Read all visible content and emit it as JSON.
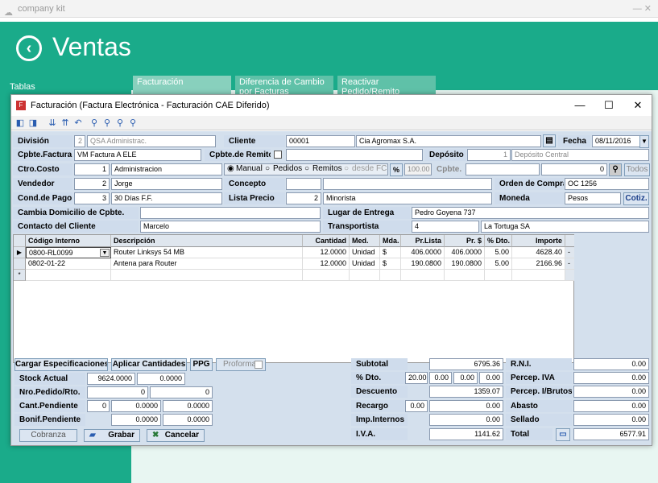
{
  "os": {
    "title": "company kit",
    "controls": "— ✕"
  },
  "app": {
    "title": "Ventas",
    "sidebar_label": "Tablas"
  },
  "tabs": [
    "Facturación",
    "Diferencia de Cambio por Facturas",
    "Reactivar Pedido/Remito facturado"
  ],
  "dialog": {
    "title": "Facturación  (Factura Electrónica - Facturación CAE Diferido)"
  },
  "labels": {
    "division": "División",
    "cliente": "Cliente",
    "fecha": "Fecha",
    "cpbte_factura": "Cpbte.Factura",
    "cpbte_remito": "Cpbte.de Remito",
    "deposito": "Depósito",
    "ctro_costo": "Ctro.Costo",
    "cpbte": "Cpbte.",
    "vendedor": "Vendedor",
    "concepto": "Concepto",
    "orden_compra": "Orden de Compra",
    "cond_pago": "Cond.de Pago",
    "lista_precio": "Lista Precio",
    "moneda": "Moneda",
    "cambia_domicilio": "Cambia Domicilio de Cpbte.",
    "lugar_entrega": "Lugar de Entrega",
    "contacto": "Contacto del Cliente",
    "transportista": "Transportista",
    "manual": "Manual",
    "pedidos": "Pedidos",
    "remitos": "Remitos",
    "desde_fc": "desde FC",
    "pct": "%"
  },
  "values": {
    "division_code": "2",
    "division_name": "QSA Administrac.",
    "cliente_code": "00001",
    "cliente_name": "Cia Agromax S.A.",
    "fecha": "08/11/2016",
    "cpbte_factura": "VM Factura A ELE",
    "cpbte_remito": "",
    "deposito_code": "1",
    "deposito_name": "Depósito Central",
    "ctro_code": "1",
    "ctro_name": "Administracion",
    "pct_val": "100.00",
    "cpbte_num": "0",
    "vendedor_code": "2",
    "vendedor_name": "Jorge",
    "concepto": "",
    "orden_compra": "OC 1256",
    "cond_code": "3",
    "cond_name": "30 Días F.F.",
    "lista_code": "2",
    "lista_name": "Minorista",
    "moneda": "Pesos",
    "cambia_domicilio": "",
    "lugar_entrega": "Pedro Goyena 737",
    "contacto": "Marcelo",
    "transp_code": "4",
    "transp_name": "La Tortuga  SA"
  },
  "buttons": {
    "todos": "Todos",
    "cotiz": "Cotiz.",
    "cargar": "Cargar Especificaciones",
    "aplicar": "Aplicar Cantidades",
    "ppg": "PPG",
    "proforma": "Proforma",
    "cobranza": "Cobranza",
    "grabar": "Grabar",
    "cancelar": "Cancelar"
  },
  "grid": {
    "headers": [
      "Código Interno",
      "Descripción",
      "Cantidad",
      "Med.",
      "Mda.",
      "Pr.Lista",
      "Pr. $",
      "% Dto.",
      "Importe"
    ],
    "rows": [
      {
        "marker": "▶",
        "codigo": "0800-RL0099",
        "desc": "Router Linksys 54 MB",
        "cant": "12.0000",
        "med": "Unidad",
        "mda": "$",
        "prlista": "406.0000",
        "pr": "406.0000",
        "dto": "5.00",
        "importe": "4628.40"
      },
      {
        "marker": "",
        "codigo": "0802-01-22",
        "desc": "Antena para Router",
        "cant": "12.0000",
        "med": "Unidad",
        "mda": "$",
        "prlista": "190.0800",
        "pr": "190.0800",
        "dto": "5.00",
        "importe": "2166.96"
      }
    ],
    "new_marker": "*",
    "del": "-"
  },
  "bottom": {
    "stock_label": "Stock Actual",
    "stock1": "9624.0000",
    "stock2": "0.0000",
    "nro_label": "Nro.Pedido/Rto.",
    "nro1": "0",
    "nro2": "0",
    "cant_label": "Cant.Pendiente",
    "cant1": "0",
    "cant2": "0.0000",
    "cant3": "0.0000",
    "bonif_label": "Bonif.Pendiente",
    "bonif1": "0.0000",
    "bonif2": "0.0000"
  },
  "totals": {
    "subtotal_label": "Subtotal",
    "subtotal": "6795.36",
    "dto_label": "% Dto.",
    "dto1": "20.00",
    "dto2": "0.00",
    "dto3": "0.00",
    "dto4": "0.00",
    "descuento_label": "Descuento",
    "descuento": "1359.07",
    "recargo_label": "Recargo",
    "recargo1": "0.00",
    "recargo2": "0.00",
    "imp_label": "Imp.Internos",
    "imp": "0.00",
    "iva_label": "I.V.A.",
    "iva": "1141.62",
    "rni_label": "R.N.I.",
    "rni": "0.00",
    "perc_iva_label": "Percep. IVA",
    "perc_iva": "0.00",
    "perc_ib_label": "Percep. I/Brutos",
    "perc_ib": "0.00",
    "abasto_label": "Abasto",
    "abasto": "0.00",
    "sellado_label": "Sellado",
    "sellado": "0.00",
    "total_label": "Total",
    "total": "6577.91"
  }
}
